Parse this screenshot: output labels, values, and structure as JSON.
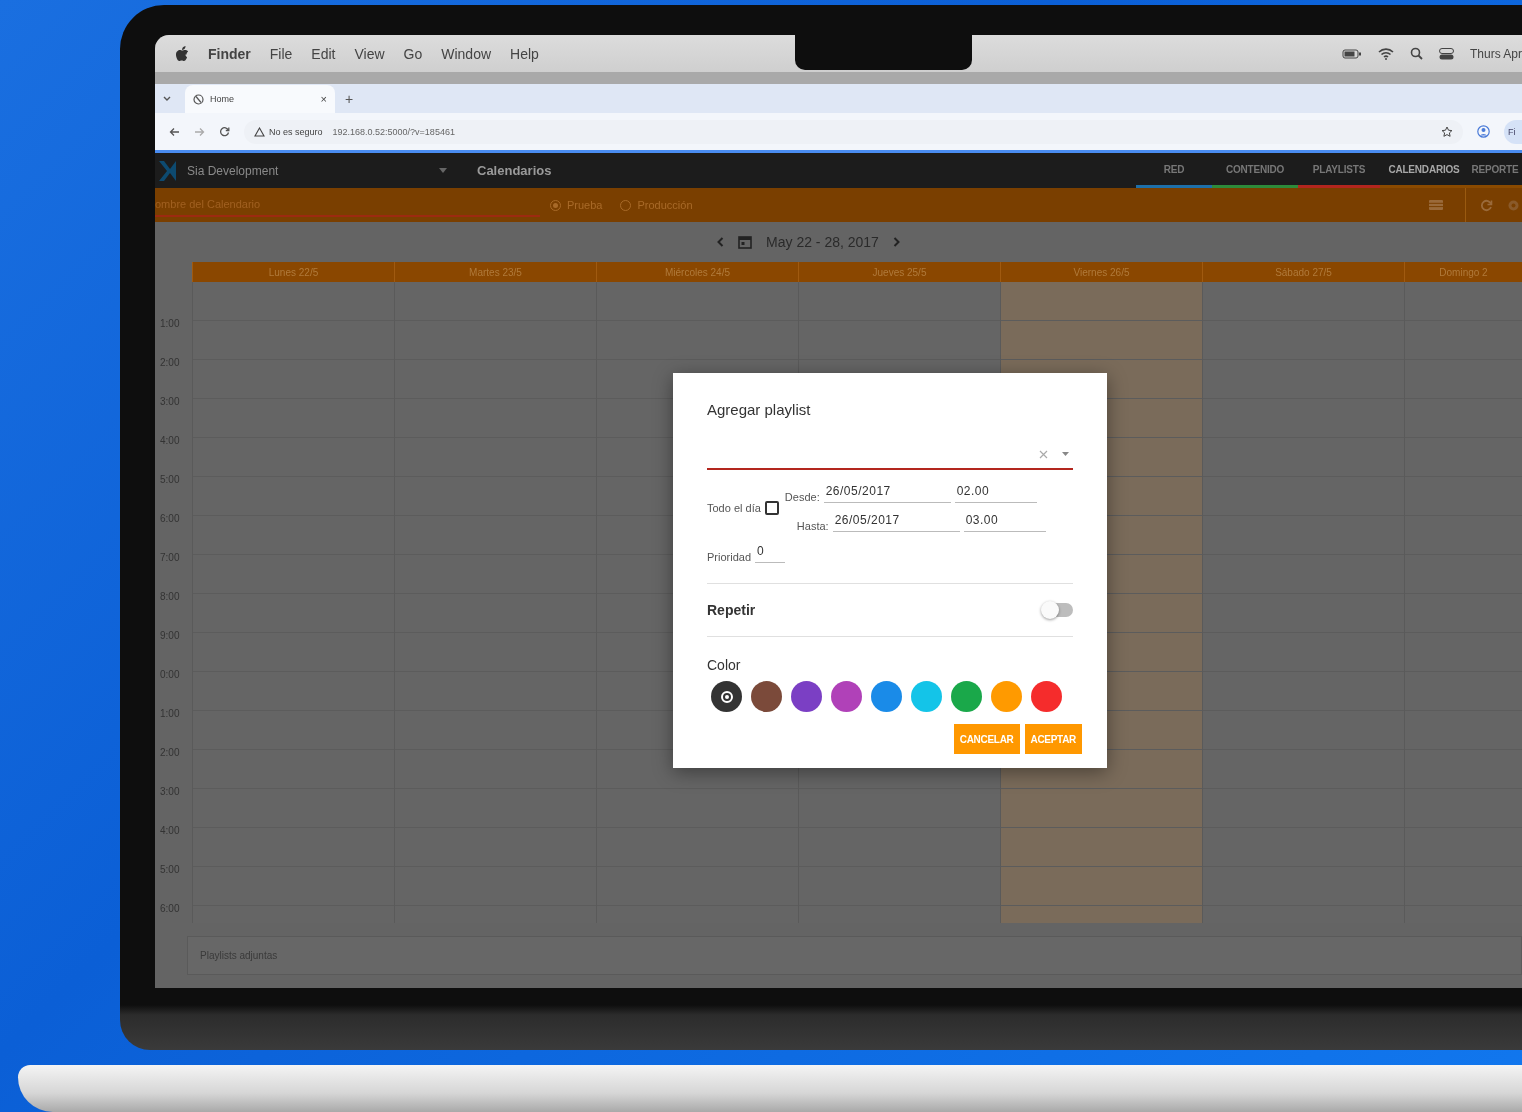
{
  "menu_bar": {
    "app": "Finder",
    "items": [
      "File",
      "Edit",
      "View",
      "Go",
      "Window",
      "Help"
    ],
    "clock": "Thurs Apr"
  },
  "browser": {
    "tab": {
      "title": "Home",
      "close": "×"
    },
    "new_tab": "+",
    "security": "No es seguro",
    "url": "192.168.0.52:5000/?v=185461",
    "profile": "Fi"
  },
  "app_header": {
    "workspace": "Sia Development",
    "title": "Calendarios",
    "tabs": [
      {
        "label": "RED",
        "color": "#1e6fa8",
        "selected": false
      },
      {
        "label": "CONTENIDO",
        "color": "#2e8b3a",
        "selected": false
      },
      {
        "label": "PLAYLISTS",
        "color": "#b3261e",
        "selected": false
      },
      {
        "label": "CALENDARIOS",
        "color": "#8a4a00",
        "selected": true
      },
      {
        "label": "REPORTE",
        "color": "#8a4a00",
        "selected": false
      }
    ]
  },
  "toolbar": {
    "name_placeholder": "ombre del Calendario",
    "modes": [
      {
        "label": "Prueba",
        "selected": true
      },
      {
        "label": "Producción",
        "selected": false
      }
    ]
  },
  "week_nav": {
    "range": "May 22 - 28, 2017"
  },
  "calendar": {
    "days": [
      {
        "label": "Lunes 22/5",
        "highlighted": false
      },
      {
        "label": "Martes 23/5",
        "highlighted": false
      },
      {
        "label": "Miércoles 24/5",
        "highlighted": false
      },
      {
        "label": "Jueves 25/5",
        "highlighted": false
      },
      {
        "label": "Viernes 26/5",
        "highlighted": true
      },
      {
        "label": "Sábado 27/5",
        "highlighted": false
      },
      {
        "label": "Domingo 2",
        "highlighted": false
      }
    ],
    "hours": [
      "1:00",
      "2:00",
      "3:00",
      "4:00",
      "5:00",
      "6:00",
      "7:00",
      "8:00",
      "9:00",
      "0:00",
      "1:00",
      "2:00",
      "3:00",
      "4:00",
      "5:00",
      "6:00"
    ]
  },
  "footer": {
    "title": "Playlists adjuntas"
  },
  "dialog": {
    "title": "Agregar playlist",
    "all_day": {
      "label": "Todo el día",
      "checked": false
    },
    "from": {
      "label": "Desde:",
      "date": "26/05/2017",
      "time": "02.00"
    },
    "to": {
      "label": "Hasta:",
      "date": "26/05/2017",
      "time": "03.00"
    },
    "priority": {
      "label": "Prioridad",
      "value": "0"
    },
    "repeat": {
      "label": "Repetir",
      "on": false
    },
    "color": {
      "label": "Color",
      "swatches": [
        {
          "color": "#333333",
          "selected": true
        },
        {
          "color": "#7b4a3a",
          "selected": false
        },
        {
          "color": "#7b3fc4",
          "selected": false
        },
        {
          "color": "#b041b8",
          "selected": false
        },
        {
          "color": "#1a8be8",
          "selected": false
        },
        {
          "color": "#14c4e8",
          "selected": false
        },
        {
          "color": "#1aa84a",
          "selected": false
        },
        {
          "color": "#ff9a00",
          "selected": false
        },
        {
          "color": "#f52c2c",
          "selected": false
        }
      ]
    },
    "buttons": [
      "CANCELAR",
      "ACEPTAR"
    ]
  }
}
